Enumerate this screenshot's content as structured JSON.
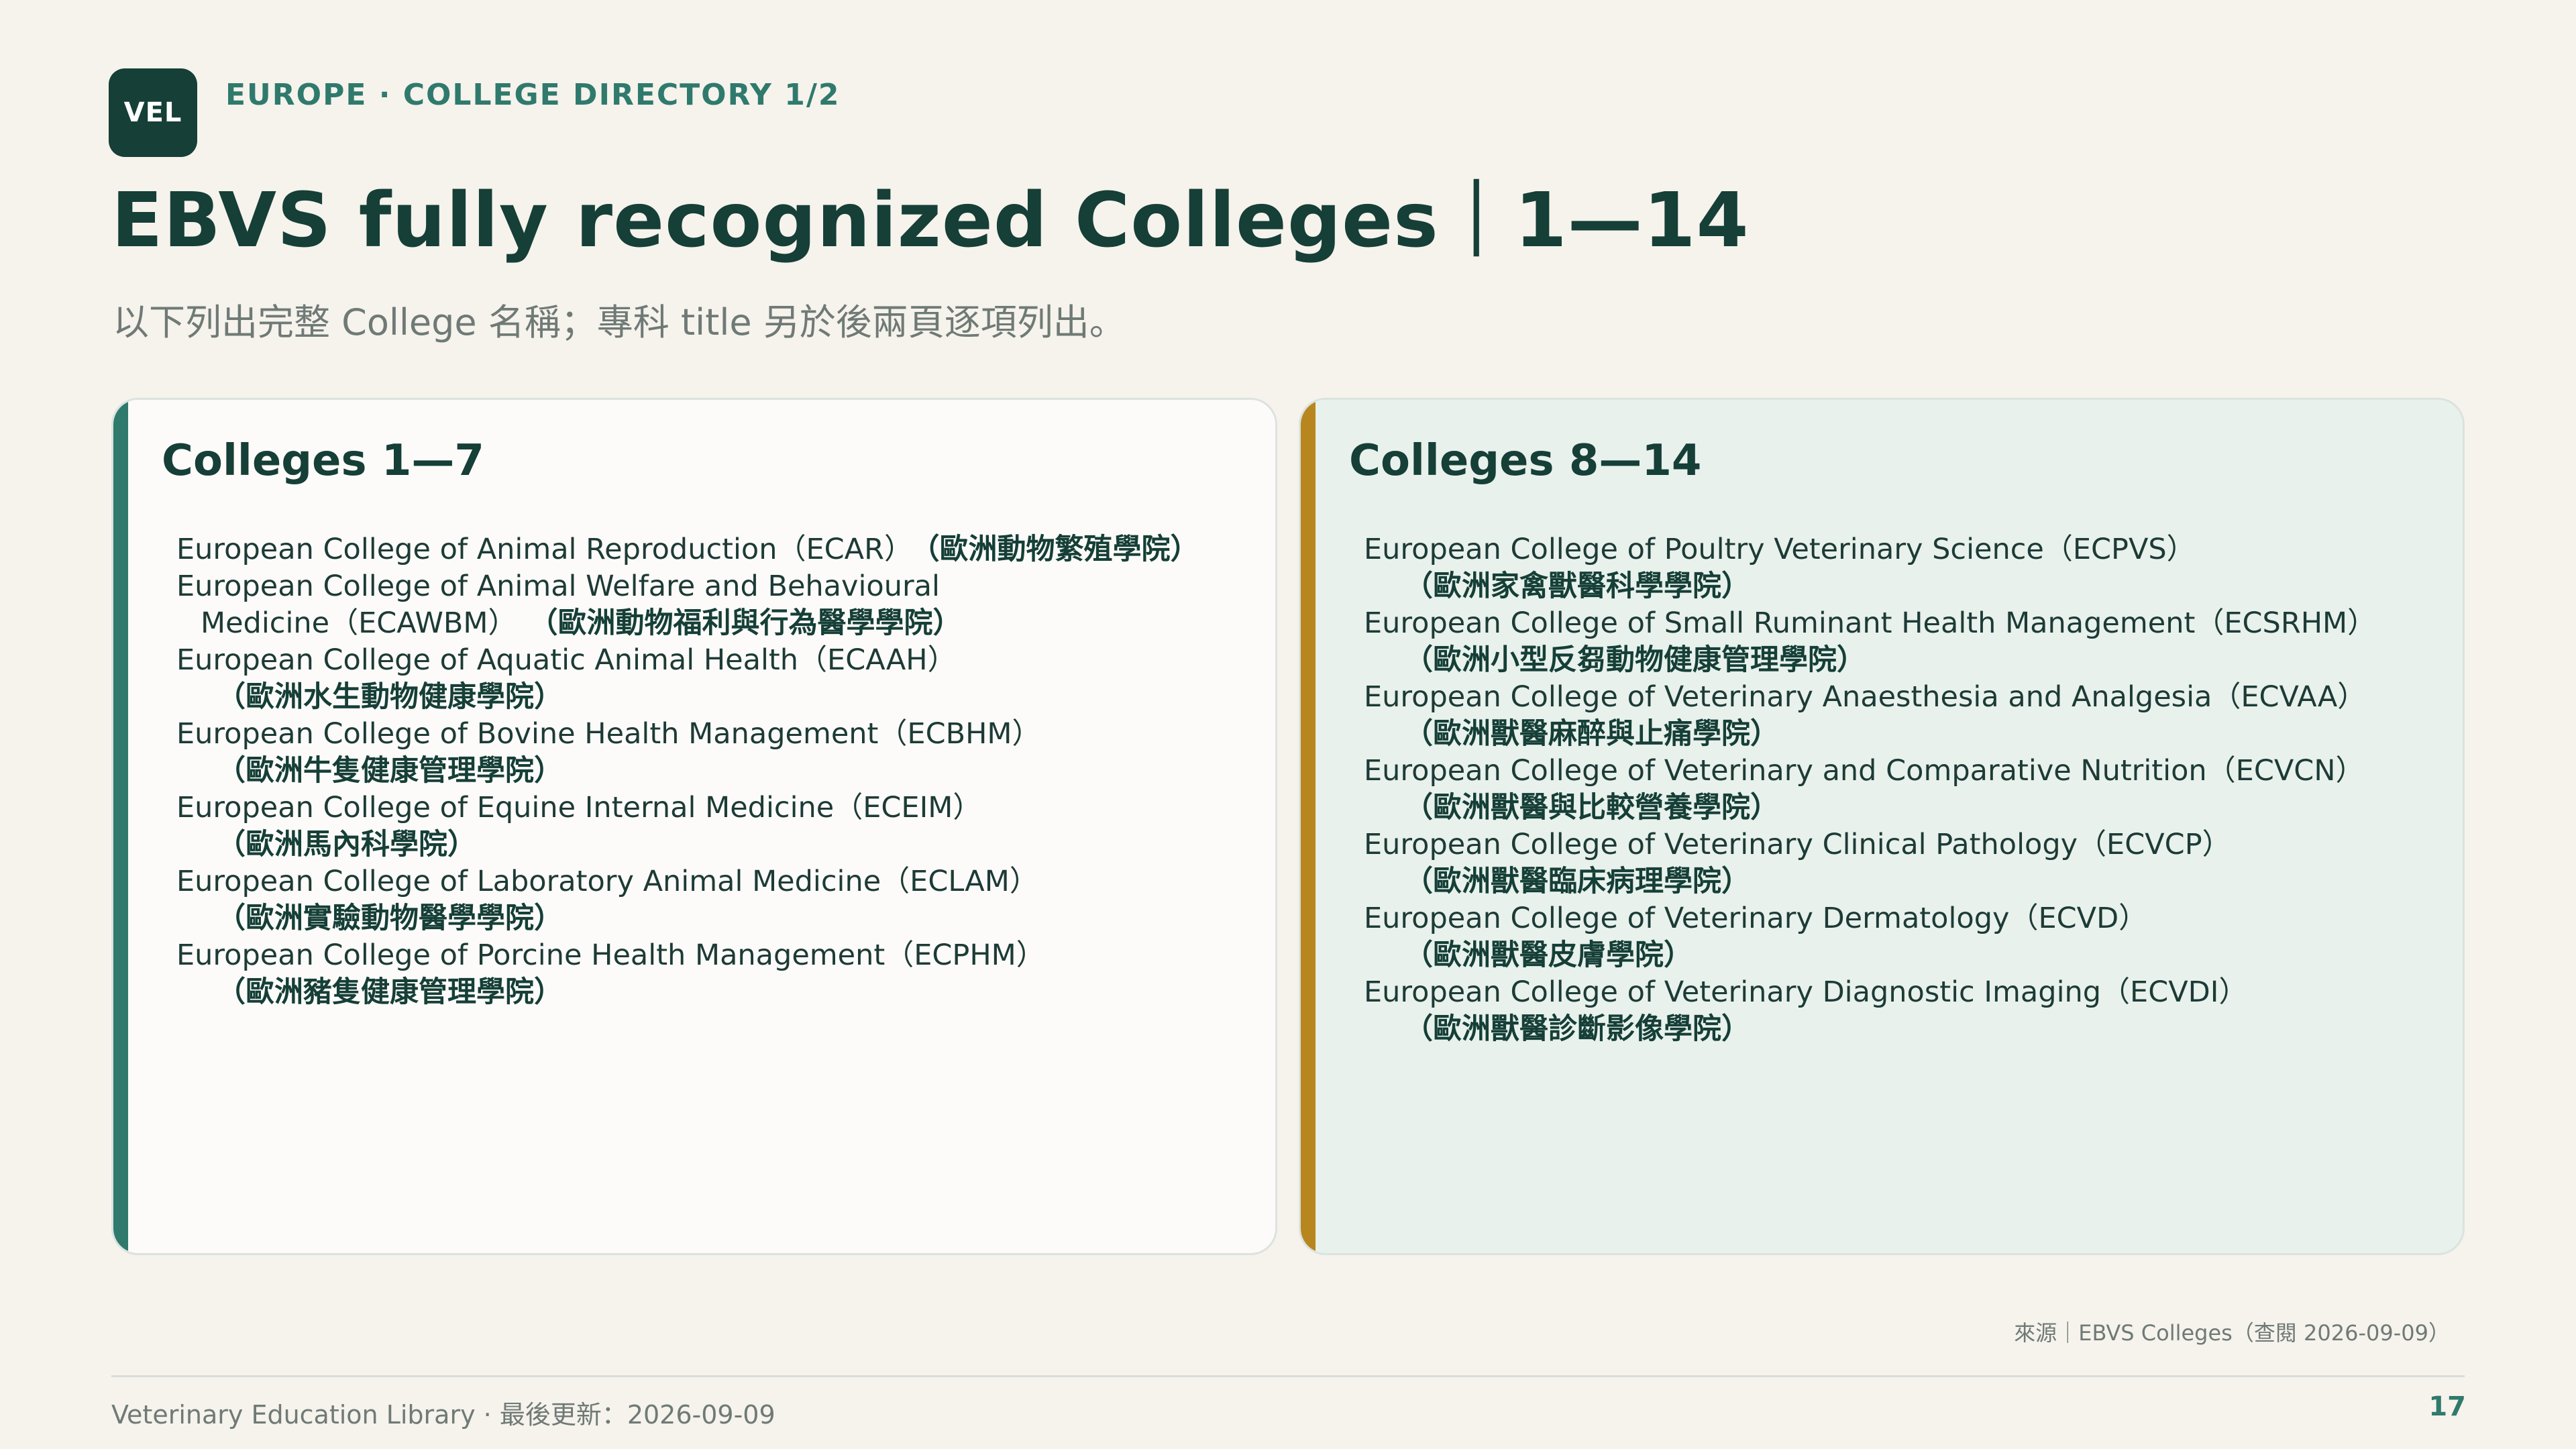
{
  "logo": {
    "text": "VEL"
  },
  "header": {
    "kicker": "EUROPE · COLLEGE DIRECTORY 1/2",
    "title": "EBVS fully recognized Colleges｜1—14",
    "subtitle": "以下列出完整 College 名稱；專科 title 另於後兩頁逐項列出。"
  },
  "left_card": {
    "title": "Colleges 1—7",
    "entry_0": {
      "en": "European College of Animal Reproduction（ECAR）",
      "zh": "（歐洲動物繁殖學院）"
    },
    "entry_1": {
      "en_line1": "European College of Animal Welfare and Behavioural",
      "en_line2": "Medicine（ECAWBM）",
      "zh": "（歐洲動物福利與行為醫學學院）"
    },
    "entry_2": {
      "en": "European College of Aquatic Animal Health（ECAAH）",
      "zh": "（歐洲水生動物健康學院）"
    },
    "entry_3": {
      "en": "European College of Bovine Health Management（ECBHM）",
      "zh": "（歐洲牛隻健康管理學院）"
    },
    "entry_4": {
      "en": "European College of Equine Internal Medicine（ECEIM）",
      "zh": "（歐洲馬內科學院）"
    },
    "entry_5": {
      "en": "European College of Laboratory Animal Medicine（ECLAM）",
      "zh": "（歐洲實驗動物醫學學院）"
    },
    "entry_6": {
      "en": "European College of Porcine Health Management（ECPHM）",
      "zh": "（歐洲豬隻健康管理學院）"
    }
  },
  "right_card": {
    "title": "Colleges 8—14",
    "entry_0": {
      "en": "European College of Poultry Veterinary Science（ECPVS）",
      "zh": "（歐洲家禽獸醫科學學院）"
    },
    "entry_1": {
      "en": "European College of Small Ruminant Health Management（ECSRHM）",
      "zh": "（歐洲小型反芻動物健康管理學院）"
    },
    "entry_2": {
      "en": "European College of Veterinary Anaesthesia and Analgesia（ECVAA）",
      "zh": "（歐洲獸醫麻醉與止痛學院）"
    },
    "entry_3": {
      "en": "European College of Veterinary and Comparative Nutrition（ECVCN）",
      "zh": "（歐洲獸醫與比較營養學院）"
    },
    "entry_4": {
      "en": "European College of Veterinary Clinical Pathology（ECVCP）",
      "zh": "（歐洲獸醫臨床病理學院）"
    },
    "entry_5": {
      "en": "European College of Veterinary Dermatology（ECVD）",
      "zh": "（歐洲獸醫皮膚學院）"
    },
    "entry_6": {
      "en": "European College of Veterinary Diagnostic Imaging（ECVDI）",
      "zh": "（歐洲獸醫診斷影像學院）"
    }
  },
  "source": "來源｜EBVS Colleges（查閱 2026-09-09）",
  "footer": {
    "text": "Veterinary Education Library · 最後更新：2026-09-09",
    "page_number": "17"
  },
  "colors": {
    "background": "#f6f2ec",
    "brand_dark": "#153f37",
    "teal_accent": "#2f7a6c",
    "gold_accent": "#b8861f",
    "right_card_bg": "#e9f1ec"
  }
}
